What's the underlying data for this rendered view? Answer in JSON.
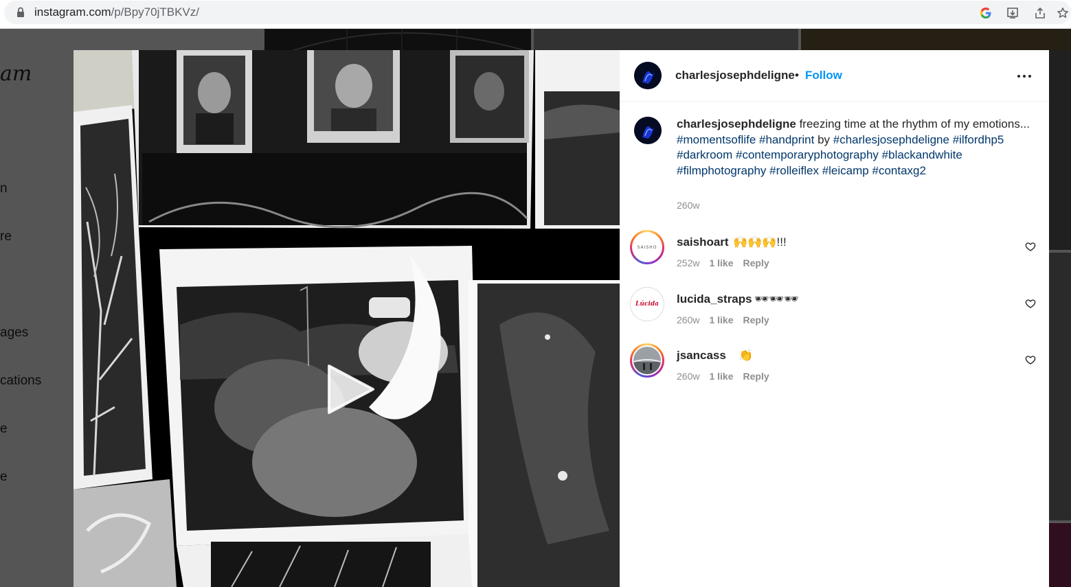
{
  "browser": {
    "url_domain": "instagram.com",
    "url_path": "/p/Bpy70jTBKVz/"
  },
  "background_page": {
    "logo": "am",
    "nav_items": [
      "n",
      "re",
      "ages",
      "cations",
      "e",
      "e"
    ]
  },
  "post": {
    "author": "charlesjosephdeligne",
    "follow_label": "Follow",
    "separator": "•",
    "caption_lead": "freezing time at the rhythm of my emotions... ",
    "caption_parts": [
      {
        "type": "tag",
        "text": "#momentsoflife"
      },
      {
        "type": "text",
        "text": " "
      },
      {
        "type": "tag",
        "text": "#handprint"
      },
      {
        "type": "text",
        "text": " by "
      },
      {
        "type": "tag",
        "text": "#charlesjosephdeligne"
      },
      {
        "type": "text",
        "text": " "
      },
      {
        "type": "tag",
        "text": "#ilfordhp5"
      },
      {
        "type": "text",
        "text": " "
      },
      {
        "type": "tag",
        "text": "#darkroom"
      },
      {
        "type": "text",
        "text": " "
      },
      {
        "type": "tag",
        "text": "#contemporaryphotography"
      },
      {
        "type": "text",
        "text": " "
      },
      {
        "type": "tag",
        "text": "#blackandwhite"
      },
      {
        "type": "text",
        "text": " "
      },
      {
        "type": "tag",
        "text": "#filmphotography"
      },
      {
        "type": "text",
        "text": " "
      },
      {
        "type": "tag",
        "text": "#rolleiflex"
      },
      {
        "type": "text",
        "text": " "
      },
      {
        "type": "tag",
        "text": "#leicamp"
      },
      {
        "type": "text",
        "text": " "
      },
      {
        "type": "tag",
        "text": "#contaxg2"
      }
    ],
    "caption_time": "260w"
  },
  "comments": [
    {
      "user": "saishoart",
      "text": "🙌🙌🙌!!!",
      "time": "252w",
      "likes": "1 like",
      "reply": "Reply",
      "avatar_label": "SAISHO"
    },
    {
      "user": "lucida_straps",
      "text": "🕶🕶🕶",
      "time": "260w",
      "likes": "1 like",
      "reply": "Reply",
      "avatar_label": "Lúcida"
    },
    {
      "user": "jsancass",
      "text": "👏",
      "time": "260w",
      "likes": "1 like",
      "reply": "Reply",
      "avatar_label": ""
    }
  ]
}
